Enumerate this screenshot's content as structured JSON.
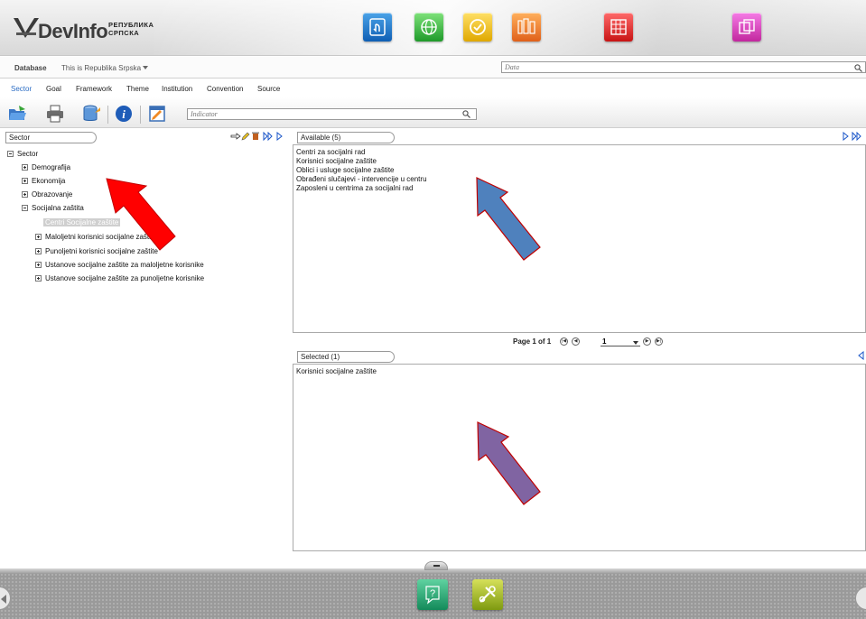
{
  "header": {
    "logo_text": "DevInfo",
    "logo_sub_line1": "РЕПУБЛИКА",
    "logo_sub_line2": "СРПСКА",
    "app_icons": [
      "touch-select-icon",
      "globe-icon",
      "check-icon",
      "gallery-icon",
      "table-grid-icon",
      "gallery-stack-icon"
    ]
  },
  "database_bar": {
    "label": "Database",
    "value": "This is Republika Srpska",
    "search_placeholder": "Data"
  },
  "tabs": [
    "Sector",
    "Goal",
    "Framework",
    "Theme",
    "Institution",
    "Convention",
    "Source"
  ],
  "toolbar": {
    "icons": [
      "open-folder-icon",
      "print-icon",
      "database-icon",
      "info-icon",
      "edit-window-icon"
    ],
    "indicator_placeholder": "Indicator"
  },
  "left_panel": {
    "title": "Sector",
    "tree": {
      "root": "Sector",
      "items": [
        {
          "label": "Demografija",
          "level": 1,
          "expanded": false
        },
        {
          "label": "Ekonomija",
          "level": 1,
          "expanded": false
        },
        {
          "label": "Obrazovanje",
          "level": 1,
          "expanded": false
        },
        {
          "label": "Socijalna zaštita",
          "level": 1,
          "expanded": true
        },
        {
          "label": "Centri Socijalne zaštite",
          "level": 2,
          "selected": true
        },
        {
          "label": "Maloljetni korisnici socijalne zaštite",
          "level": 2,
          "expanded": false
        },
        {
          "label": "Punoljetni korisnici socijalne zaštite",
          "level": 2,
          "expanded": false
        },
        {
          "label": "Ustanove socijalne zaštite za maloljetne korisnike",
          "level": 2,
          "expanded": false
        },
        {
          "label": "Ustanove socijalne zaštite za punoljetne korisnike",
          "level": 2,
          "expanded": false
        }
      ]
    }
  },
  "available": {
    "title": "Available (5)",
    "items": [
      "Centri za socijalni rad",
      "Korisnici socijalne zaštite",
      "Oblici i usluge socijalne zaštite",
      "Obrađeni slučajevi - intervencije u centru",
      "Zaposleni u centrima za socijalni rad"
    ]
  },
  "pager": {
    "text": "Page 1 of 1",
    "current": "1"
  },
  "selected": {
    "title": "Selected (1)",
    "items": [
      "Korisnici socijalne zaštite"
    ]
  },
  "footer": {
    "icons": [
      "help-icon",
      "tools-icon"
    ]
  },
  "colors": {
    "tab_active": "#2b6cc4",
    "arrow_red": "#ff0000",
    "arrow_blue": "#4f81bd",
    "arrow_purple": "#8064a2"
  }
}
